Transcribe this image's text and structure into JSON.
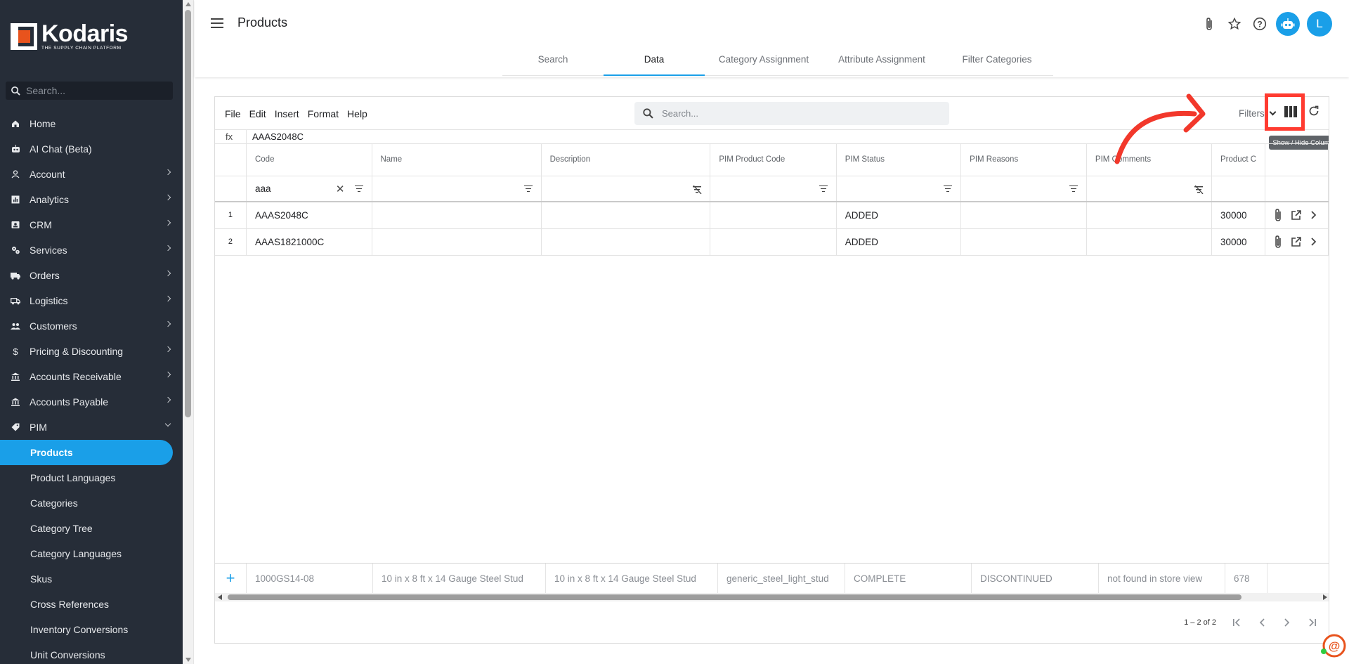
{
  "brand": {
    "name": "Kodaris",
    "tagline": "THE SUPPLY CHAIN PLATFORM",
    "accent": "#1a9fe8",
    "logo_color": "#e8531d",
    "sidebar_bg": "#262d38"
  },
  "sidebar": {
    "search_placeholder": "Search...",
    "items": [
      {
        "label": "Home",
        "icon": "home-icon"
      },
      {
        "label": "AI Chat (Beta)",
        "icon": "robot-icon"
      },
      {
        "label": "Account",
        "icon": "person-icon"
      },
      {
        "label": "Analytics",
        "icon": "analytics-icon"
      },
      {
        "label": "CRM",
        "icon": "contact-card-icon"
      },
      {
        "label": "Services",
        "icon": "gears-icon"
      },
      {
        "label": "Orders",
        "icon": "truck-icon"
      },
      {
        "label": "Logistics",
        "icon": "delivery-truck-icon"
      },
      {
        "label": "Customers",
        "icon": "people-icon"
      },
      {
        "label": "Pricing & Discounting",
        "icon": "dollar-icon"
      },
      {
        "label": "Accounts Receivable",
        "icon": "bank-icon"
      },
      {
        "label": "Accounts Payable",
        "icon": "bank-icon"
      },
      {
        "label": "PIM",
        "icon": "tag-icon"
      }
    ],
    "pim_sub": [
      "Products",
      "Product Languages",
      "Categories",
      "Category Tree",
      "Category Languages",
      "Skus",
      "Cross References",
      "Inventory Conversions",
      "Unit Conversions"
    ]
  },
  "header": {
    "title": "Products",
    "avatar_initial": "L"
  },
  "tabs": [
    "Search",
    "Data",
    "Category Assignment",
    "Attribute Assignment",
    "Filter Categories"
  ],
  "sheet": {
    "menu": [
      "File",
      "Edit",
      "Insert",
      "Format",
      "Help"
    ],
    "search_placeholder": "Search...",
    "filters_label": "Filters",
    "tooltip": "Show / Hide Columns",
    "fx_label": "fx",
    "fx_value": "AAAS2048C",
    "columns": [
      "Code",
      "Name",
      "Description",
      "PIM Product Code",
      "PIM Status",
      "PIM Reasons",
      "PIM Comments",
      "Product C"
    ],
    "code_filter_value": "aaa",
    "rows": [
      {
        "num": "1",
        "code": "AAAS2048C",
        "name": "",
        "description": "",
        "pim_code": "",
        "status": "ADDED",
        "reasons": "",
        "comments": "",
        "product": "30000"
      },
      {
        "num": "2",
        "code": "AAAS1821000C",
        "name": "",
        "description": "",
        "pim_code": "",
        "status": "ADDED",
        "reasons": "",
        "comments": "",
        "product": "30000"
      }
    ],
    "new_row": {
      "code": "1000GS14-08",
      "name": "10 in x 8 ft x 14 Gauge Steel Stud",
      "description": "10 in x 8 ft x 14 Gauge Steel Stud",
      "pim_code": "generic_steel_light_stud",
      "status": "COMPLETE",
      "reasons": "DISCONTINUED",
      "comments": "not found in store view",
      "product": "678"
    },
    "pager_text": "1 – 2 of 2"
  }
}
